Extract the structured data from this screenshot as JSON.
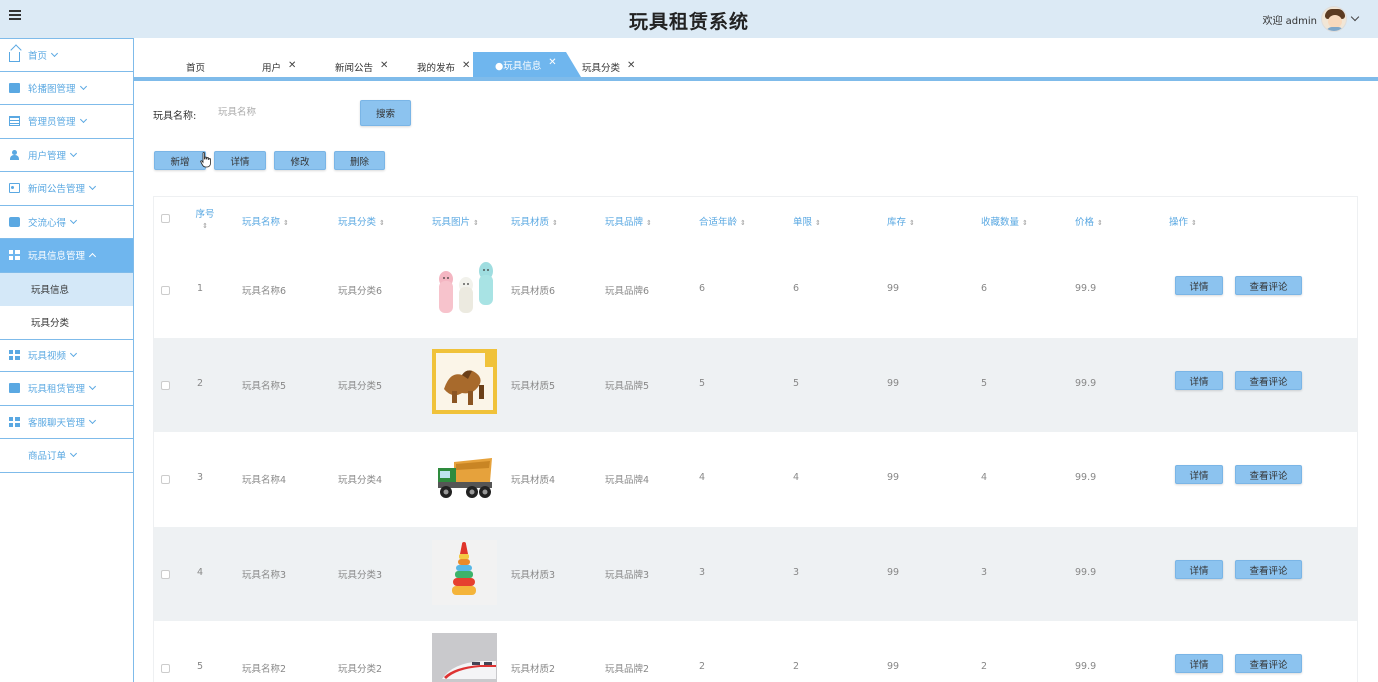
{
  "header": {
    "title": "玩具租赁系统",
    "welcome": "欢迎 admin"
  },
  "sidebar": {
    "items": [
      {
        "label": "首页",
        "icon": "home-icon"
      },
      {
        "label": "轮播图管理",
        "icon": "carousel-icon"
      },
      {
        "label": "管理员管理",
        "icon": "table-icon"
      },
      {
        "label": "用户管理",
        "icon": "user-icon"
      },
      {
        "label": "新闻公告管理",
        "icon": "news-icon"
      },
      {
        "label": "交流心得",
        "icon": "bag-icon"
      },
      {
        "label": "玩具信息管理",
        "icon": "grid-icon",
        "active": true
      },
      {
        "label": "玩具视频",
        "icon": "grid-icon"
      },
      {
        "label": "玩具租赁管理",
        "icon": "carousel-icon"
      },
      {
        "label": "客服聊天管理",
        "icon": "grid-icon"
      },
      {
        "label": "商品订单",
        "icon": ""
      }
    ],
    "sub_items": [
      {
        "label": "玩具信息",
        "selected": true
      },
      {
        "label": "玩具分类",
        "selected": false
      }
    ]
  },
  "tabs": [
    {
      "label": "首页",
      "closable": false
    },
    {
      "label": "用户",
      "closable": true
    },
    {
      "label": "新闻公告",
      "closable": true
    },
    {
      "label": "我的发布",
      "closable": true
    },
    {
      "label": "●玩具信息",
      "closable": true,
      "active": true
    },
    {
      "label": "玩具分类",
      "closable": true
    }
  ],
  "search": {
    "label": "玩具名称:",
    "placeholder": "玩具名称",
    "button": "搜索"
  },
  "toolbar": {
    "add": "新增",
    "detail": "详情",
    "edit": "修改",
    "delete": "删除"
  },
  "table": {
    "columns": [
      "序号",
      "玩具名称",
      "玩具分类",
      "玩具图片",
      "玩具材质",
      "玩具品牌",
      "合适年龄",
      "单限",
      "库存",
      "收藏数量",
      "价格",
      "操作"
    ],
    "row_actions": {
      "detail": "详情",
      "comments": "查看评论"
    },
    "rows": [
      {
        "index": "1",
        "name": "玩具名称6",
        "category": "玩具分类6",
        "image": "figurines-image",
        "material": "玩具材质6",
        "brand": "玩具品牌6",
        "age": "6",
        "limit": "6",
        "stock": "99",
        "favorites": "6",
        "price": "99.9"
      },
      {
        "index": "2",
        "name": "玩具名称5",
        "category": "玩具分类5",
        "image": "dinosaur-image",
        "material": "玩具材质5",
        "brand": "玩具品牌5",
        "age": "5",
        "limit": "5",
        "stock": "99",
        "favorites": "5",
        "price": "99.9"
      },
      {
        "index": "3",
        "name": "玩具名称4",
        "category": "玩具分类4",
        "image": "truck-image",
        "material": "玩具材质4",
        "brand": "玩具品牌4",
        "age": "4",
        "limit": "4",
        "stock": "99",
        "favorites": "4",
        "price": "99.9"
      },
      {
        "index": "4",
        "name": "玩具名称3",
        "category": "玩具分类3",
        "image": "stacking-tower-image",
        "material": "玩具材质3",
        "brand": "玩具品牌3",
        "age": "3",
        "limit": "3",
        "stock": "99",
        "favorites": "3",
        "price": "99.9"
      },
      {
        "index": "5",
        "name": "玩具名称2",
        "category": "玩具分类2",
        "image": "train-image",
        "material": "玩具材质2",
        "brand": "玩具品牌2",
        "age": "2",
        "limit": "2",
        "stock": "99",
        "favorites": "2",
        "price": "99.9"
      }
    ]
  },
  "colors": {
    "accent": "#6fb6ee",
    "button": "#8cc3ef",
    "header_bg": "#dceaf5",
    "link": "#5aa8e2"
  }
}
